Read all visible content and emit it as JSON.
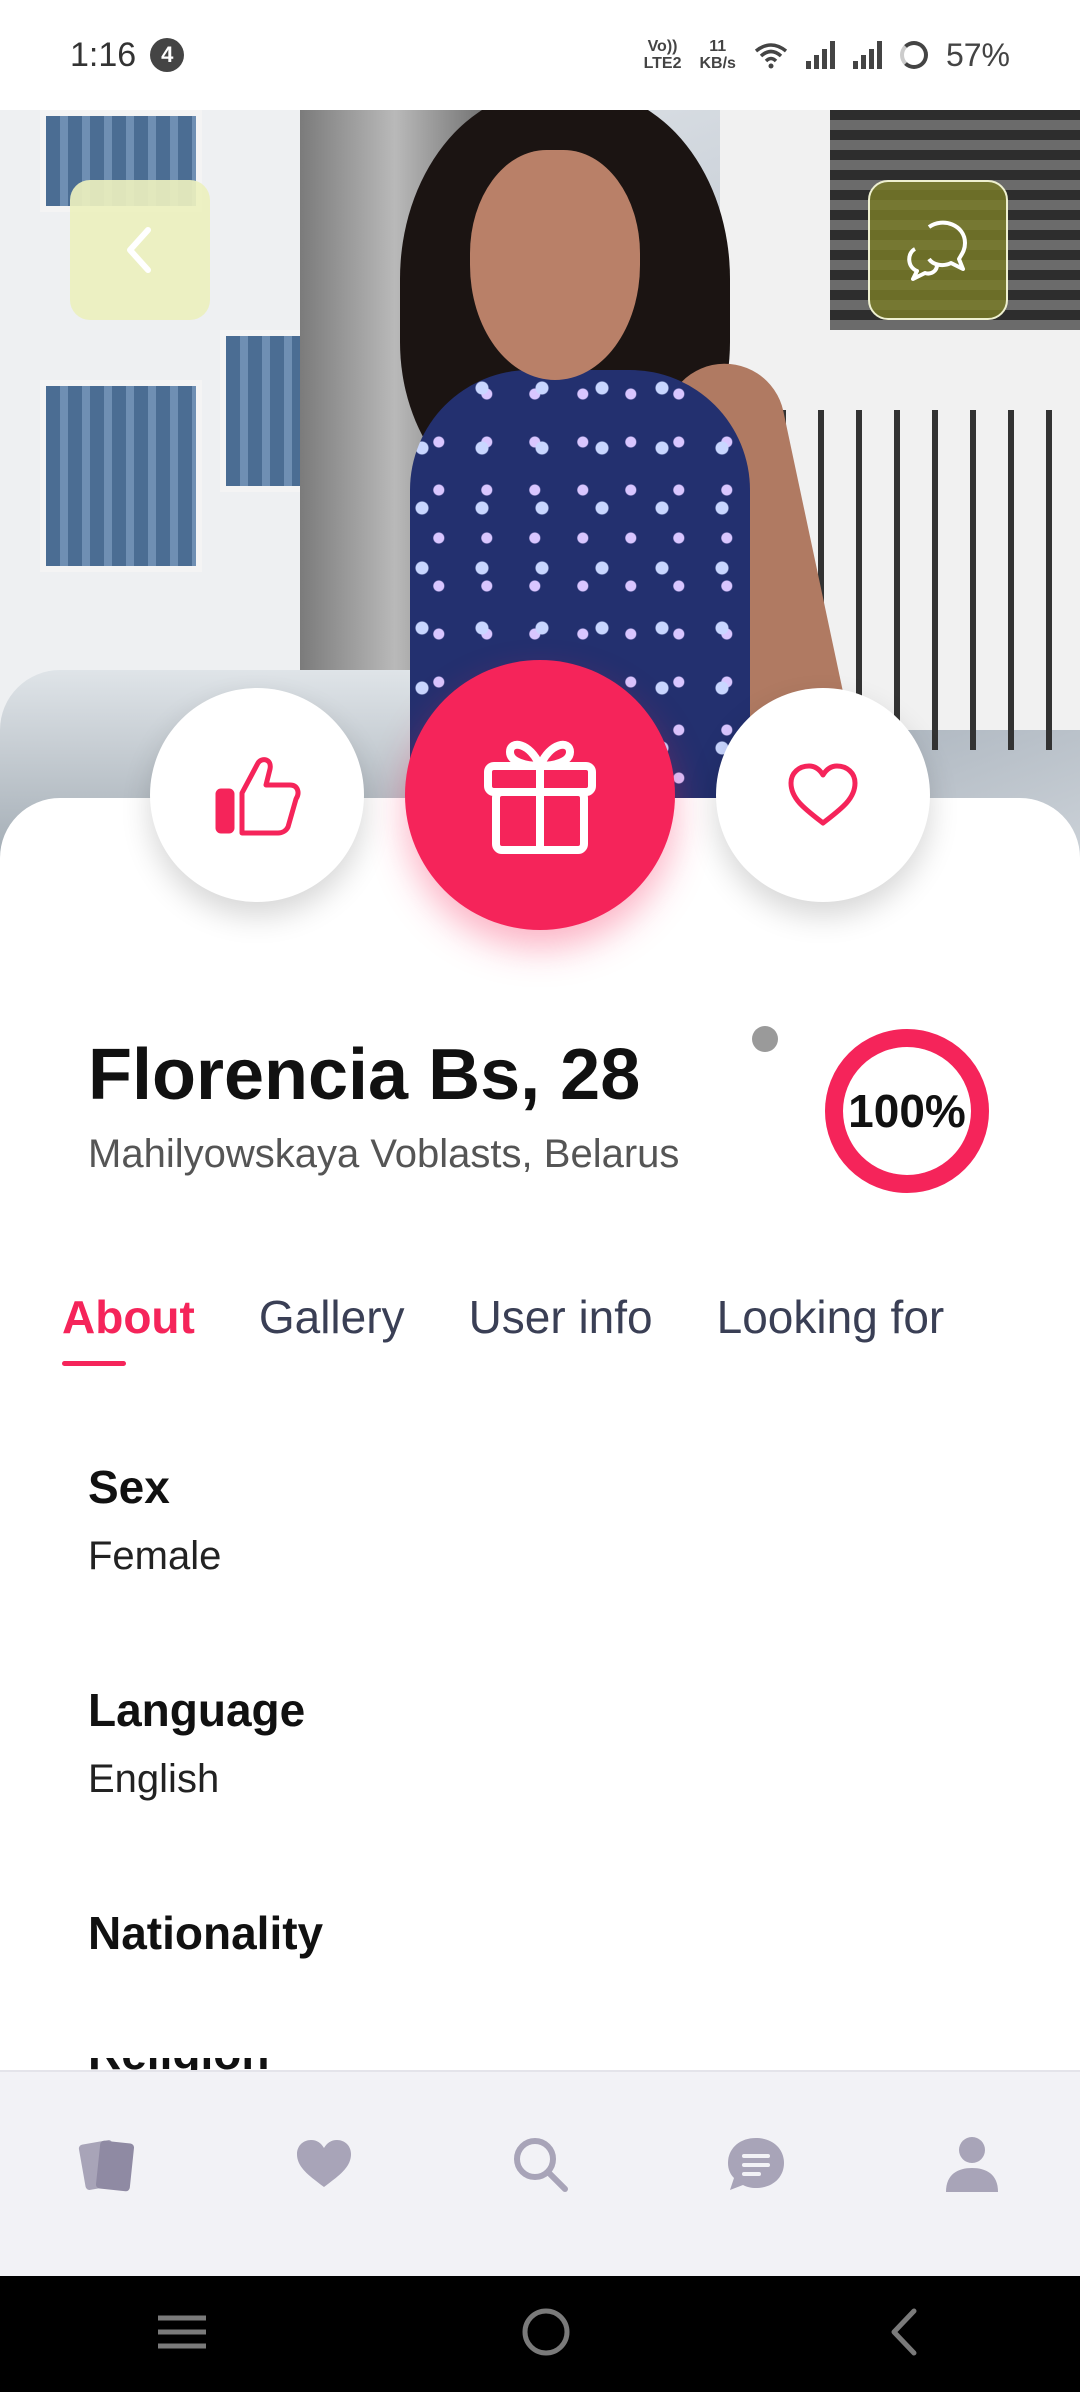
{
  "status_bar": {
    "time": "1:16",
    "notification_count": "4",
    "volte": "Vo))",
    "lte": "LTE2",
    "net_speed_value": "11",
    "net_speed_unit": "KB/s",
    "battery": "57%"
  },
  "profile": {
    "name_age": "Florencia Bs, 28",
    "location": "Mahilyowskaya Voblasts, Belarus",
    "completion": "100%",
    "completion_fraction": 1.0
  },
  "tabs": [
    {
      "label": "About",
      "active": true
    },
    {
      "label": "Gallery",
      "active": false
    },
    {
      "label": "User info",
      "active": false
    },
    {
      "label": "Looking for",
      "active": false
    }
  ],
  "about": {
    "fields": [
      {
        "label": "Sex",
        "value": "Female"
      },
      {
        "label": "Language",
        "value": "English"
      },
      {
        "label": "Nationality",
        "value": ""
      }
    ],
    "partial_label": "Religion"
  },
  "icons": {
    "back": "chevron-left-icon",
    "chat": "chat-bubbles-icon",
    "like": "thumbs-up-icon",
    "gift": "gift-icon",
    "favorite": "heart-outline-icon",
    "nav": [
      "cards-icon",
      "heart-icon",
      "search-icon",
      "chat-icon",
      "profile-icon"
    ]
  },
  "colors": {
    "accent": "#f5245a",
    "nav_icon": "#a8a4b8",
    "text_dark": "#111111",
    "tab_inactive": "#3a3f55"
  }
}
